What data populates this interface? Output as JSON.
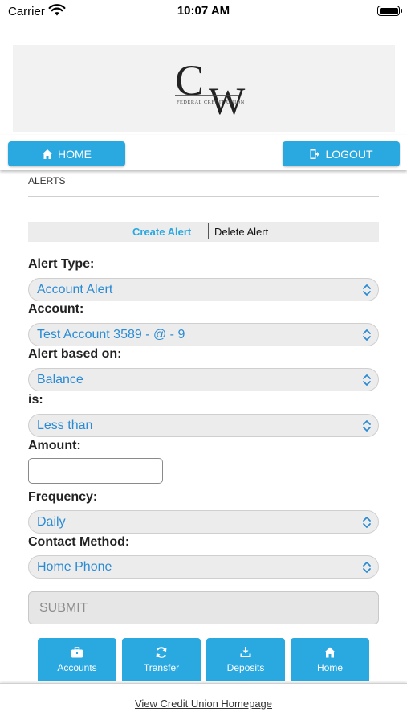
{
  "status_bar": {
    "carrier": "Carrier",
    "time": "10:07 AM"
  },
  "header": {
    "home_label": "HOME",
    "logout_label": "LOGOUT"
  },
  "section": {
    "title": "ALERTS"
  },
  "tabs": {
    "create": "Create Alert",
    "delete": "Delete Alert"
  },
  "form": {
    "alert_type_label": "Alert Type:",
    "alert_type_value": "Account Alert",
    "account_label": "Account:",
    "account_value": "Test Account 3589 - @ - 9",
    "based_on_label": "Alert based on:",
    "based_on_value": "Balance",
    "is_label": "is:",
    "is_value": "Less than",
    "amount_label": "Amount:",
    "amount_value": "",
    "frequency_label": "Frequency:",
    "frequency_value": "Daily",
    "contact_label": "Contact Method:",
    "contact_value": "Home Phone",
    "submit_label": "SUBMIT"
  },
  "bottom_nav": {
    "items": [
      {
        "label": "Accounts",
        "icon": "briefcase-icon"
      },
      {
        "label": "Transfer",
        "icon": "refresh-icon"
      },
      {
        "label": "Deposits",
        "icon": "deposit-icon"
      },
      {
        "label": "Home",
        "icon": "home-icon"
      }
    ]
  },
  "footer": {
    "link": "View Credit Union Homepage"
  },
  "colors": {
    "accent": "#2aa8e0",
    "link_blue": "#2a8bd4",
    "panel_gray": "#ececec"
  }
}
